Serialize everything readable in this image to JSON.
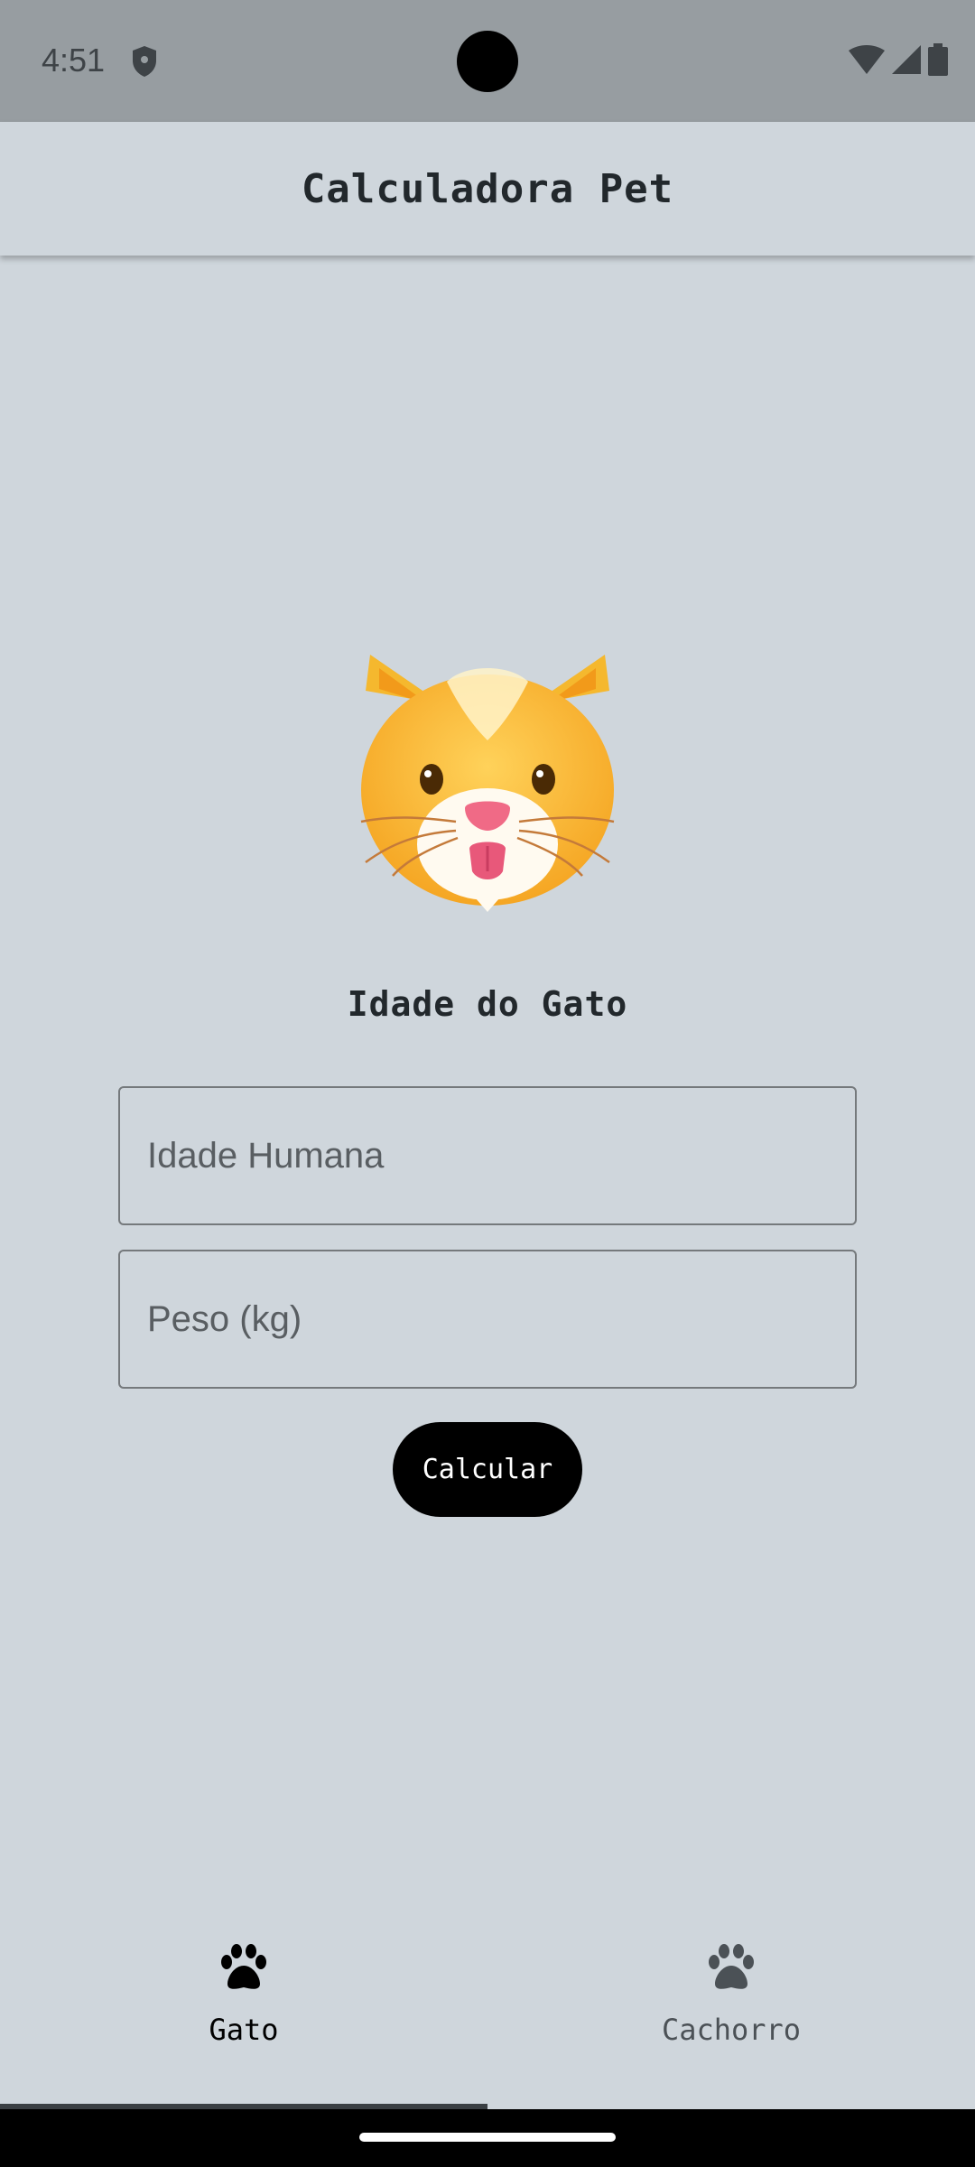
{
  "status_bar": {
    "time": "4:51",
    "icons": [
      "shield-icon",
      "wifi-icon",
      "signal-icon",
      "battery-icon"
    ]
  },
  "app_bar": {
    "title": "Calculadora Pet"
  },
  "main": {
    "illustration": "cat-face-emoji",
    "section_title": "Idade do Gato",
    "age_field": {
      "value": "",
      "placeholder": "Idade Humana"
    },
    "weight_field": {
      "value": "",
      "placeholder": "Peso (kg)"
    },
    "calculate_label": "Calcular"
  },
  "bottom_nav": {
    "items": [
      {
        "label": "Gato",
        "icon": "paw-icon",
        "selected": true
      },
      {
        "label": "Cachorro",
        "icon": "paw-icon",
        "selected": false
      }
    ]
  },
  "colors": {
    "background": "#cfd6dc",
    "status_bar": "#979da1",
    "button": "#000000",
    "button_text": "#ffffff"
  }
}
